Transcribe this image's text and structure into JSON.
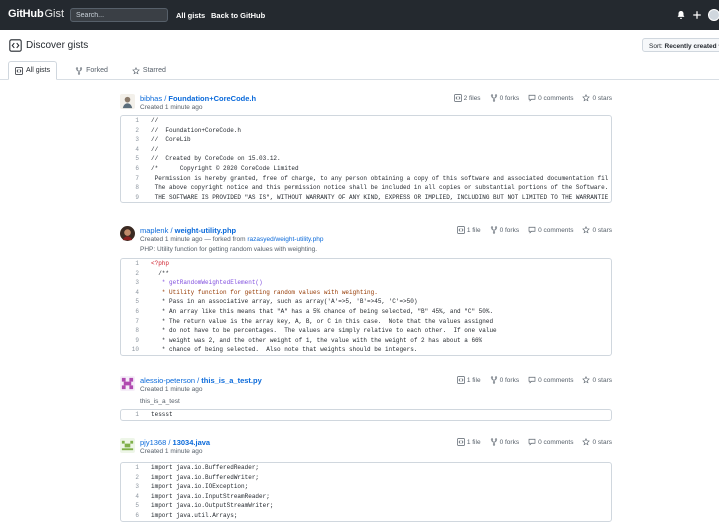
{
  "header": {
    "logo_bold": "GitHub",
    "logo_light": "Gist",
    "search_placeholder": "Search...",
    "nav": [
      "All gists",
      "Back to GitHub"
    ]
  },
  "subheader": {
    "title": "Discover gists",
    "sort_label": "Sort:",
    "sort_value": "Recently created",
    "tabs": [
      {
        "label": "All gists",
        "icon": "code-square-icon",
        "selected": true
      },
      {
        "label": "Forked",
        "icon": "fork-icon",
        "selected": false
      },
      {
        "label": "Starred",
        "icon": "star-icon",
        "selected": false
      }
    ]
  },
  "gists": [
    {
      "user": "bibhas",
      "file": "Foundation+CoreCode.h",
      "created": "Created 1 minute ago",
      "files": "2 files",
      "forks": "0 forks",
      "comments": "0 comments",
      "stars": "0 stars",
      "lines": [
        "//",
        "//  Foundation+CoreCode.h",
        "//  CoreLib",
        "//",
        "//  Created by CoreCode on 15.03.12.",
        "/*\tCopyright © 2020 CoreCode Limited",
        " Permission is hereby granted, free of charge, to any person obtaining a copy of this software and associated documentation fil",
        " The above copyright notice and this permission notice shall be included in all copies or substantial portions of the Software.",
        " THE SOFTWARE IS PROVIDED \"AS IS\", WITHOUT WARRANTY OF ANY KIND, EXPRESS OR IMPLIED, INCLUDING BUT NOT LIMITED TO THE WARRANTIE"
      ]
    },
    {
      "user": "maplenk",
      "file": "weight-utility.php",
      "created": "Created 1 minute ago",
      "forked_text": "— forked from",
      "forked_from": "razasyed/weight-utility.php",
      "description": "PHP: Utility function for getting random values with weighting.",
      "files": "1 file",
      "forks": "0 forks",
      "comments": "0 comments",
      "stars": "0 stars",
      "lines": [
        "<?php",
        "  /**",
        "   * getRandomWeightedElement()",
        "   * Utility function for getting random values with weighting.",
        "   * Pass in an associative array, such as array('A'=>5, 'B'=>45, 'C'=>50)",
        "   * An array like this means that \"A\" has a 5% chance of being selected, \"B\" 45%, and \"C\" 50%.",
        "   * The return value is the array key, A, B, or C in this case.  Note that the values assigned",
        "   * do not have to be percentages.  The values are simply relative to each other.  If one value",
        "   * weight was 2, and the other weight of 1, the value with the weight of 2 has about a 66%",
        "   * chance of being selected.  Also note that weights should be integers."
      ]
    },
    {
      "user": "alessio-peterson",
      "file": "this_is_a_test.py",
      "created": "Created 1 minute ago",
      "description": "this_is_a_test",
      "files": "1 file",
      "forks": "0 forks",
      "comments": "0 comments",
      "stars": "0 stars",
      "lines": [
        "tessst"
      ]
    },
    {
      "user": "pjy1368",
      "file": "13034.java",
      "created": "Created 1 minute ago",
      "files": "1 file",
      "forks": "0 forks",
      "comments": "0 comments",
      "stars": "0 stars",
      "lines": [
        "import java.io.BufferedReader;",
        "import java.io.BufferedWriter;",
        "import java.io.IOException;",
        "import java.io.InputStreamReader;",
        "import java.io.OutputStreamWriter;",
        "import java.util.Arrays;"
      ]
    }
  ]
}
